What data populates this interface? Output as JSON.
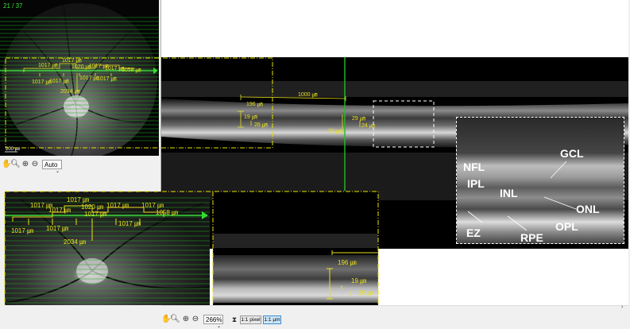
{
  "fundus": {
    "slice_counter": "21 / 37",
    "scale_label": "200 ㎛",
    "auto_select": "Auto",
    "measurements": [
      "1017 ㎛",
      "1017 ㎛",
      "1020 ㎛",
      "1017 ㎛",
      "1017 ㎛",
      "1058 ㎛",
      "1017 ㎛",
      "1017 ㎛",
      "1017 ㎛",
      "1017 ㎛",
      "2034 ㎛"
    ]
  },
  "bscan": {
    "measure_horizontal": "1000 ㎛",
    "measure_196": "196 ㎛",
    "measure_19": "19 ㎛",
    "measure_26": "26 ㎛",
    "measure_29": "29 ㎛",
    "measure_24": "24 ㎛",
    "measure_32": "32 ㎛"
  },
  "inset_zoom": {
    "layers": [
      "GCL",
      "NFL",
      "IPL",
      "INL",
      "ONL",
      "OPL",
      "EZ",
      "RPE"
    ]
  },
  "zoom_fundus": {
    "measurements": [
      "1017 ㎛",
      "1017 ㎛",
      "1017 ㎛",
      "1020 ㎛",
      "1017 ㎛",
      "1017 ㎛",
      "1058 ㎛",
      "1017 ㎛",
      "1017 ㎛",
      "1017 ㎛",
      "1017 ㎛",
      "2034 ㎛"
    ]
  },
  "zoom_bscan": {
    "measure_196": "196 ㎛",
    "measure_19": "19 ㎛",
    "measure_26": "26 ㎛"
  },
  "bottom_toolbar": {
    "zoom_select": "266%",
    "pixel_button": "1:1 pixel",
    "micron_button": "1:1 µm"
  },
  "colors": {
    "measure_yellow": "#e8e020",
    "scan_green": "#22c022",
    "dash_yellow": "#e6e000"
  }
}
